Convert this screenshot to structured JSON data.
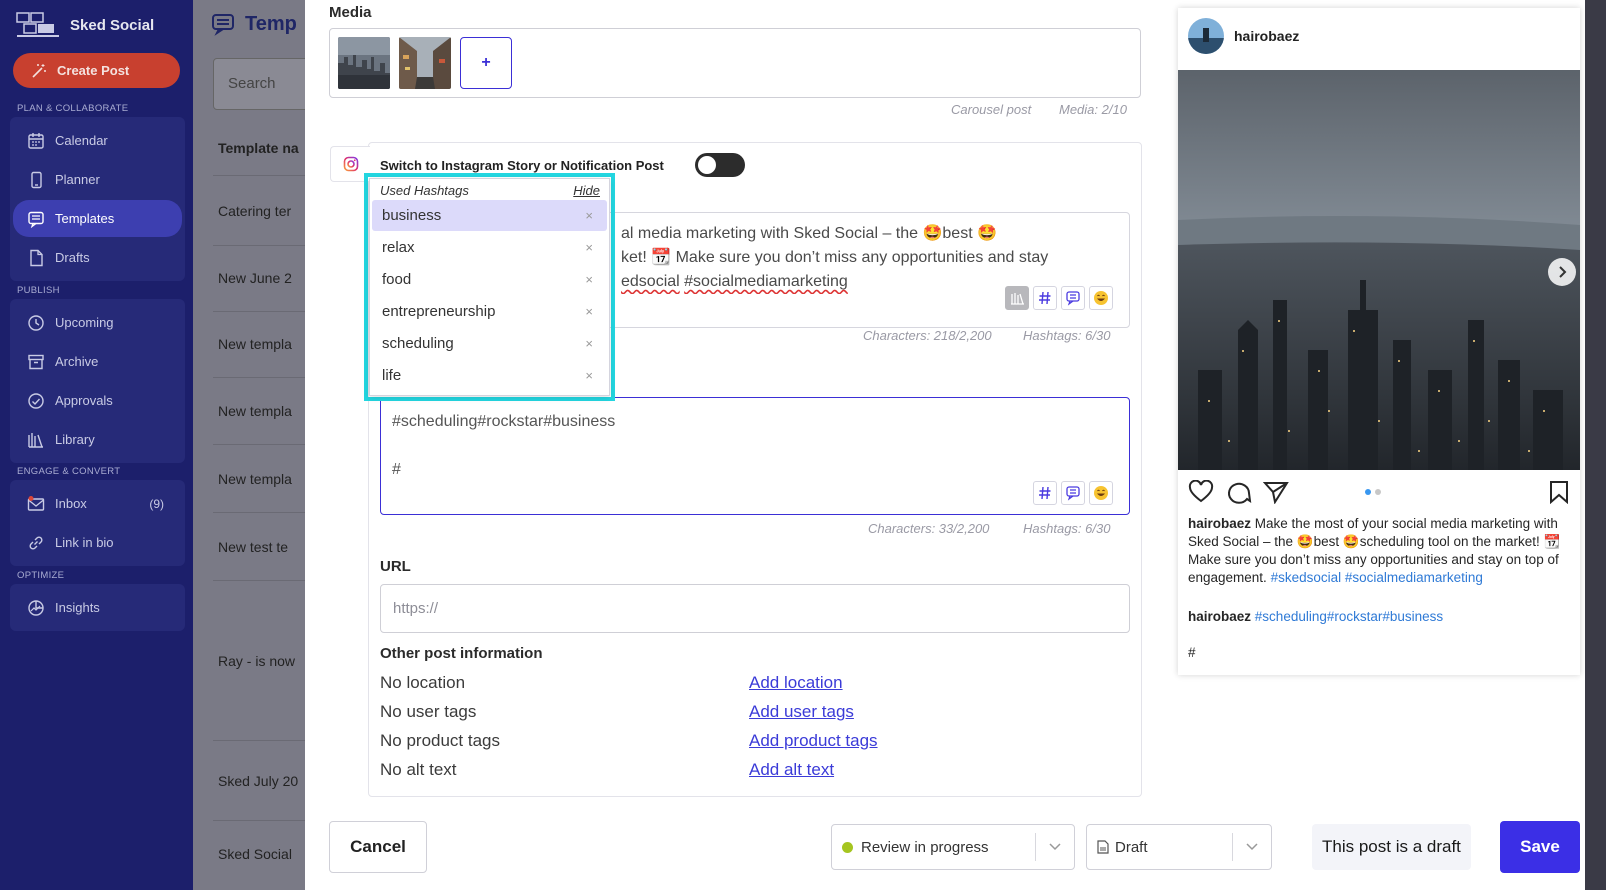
{
  "app": {
    "name": "Sked Social"
  },
  "sidebar": {
    "create_label": "Create Post",
    "sections": [
      {
        "label": "PLAN & COLLABORATE",
        "items": [
          {
            "label": "Calendar",
            "icon": "calendar-icon"
          },
          {
            "label": "Planner",
            "icon": "phone-icon"
          },
          {
            "label": "Templates",
            "icon": "chat-icon",
            "active": true
          },
          {
            "label": "Drafts",
            "icon": "document-icon"
          }
        ]
      },
      {
        "label": "PUBLISH",
        "items": [
          {
            "label": "Upcoming",
            "icon": "clock-icon"
          },
          {
            "label": "Archive",
            "icon": "archive-icon"
          },
          {
            "label": "Approvals",
            "icon": "check-circle-icon"
          },
          {
            "label": "Library",
            "icon": "library-icon"
          }
        ]
      },
      {
        "label": "ENGAGE & CONVERT",
        "items": [
          {
            "label": "Inbox",
            "icon": "mail-icon",
            "badge": "(9)"
          },
          {
            "label": "Link in bio",
            "icon": "link-icon"
          }
        ]
      },
      {
        "label": "OPTIMIZE",
        "items": [
          {
            "label": "Insights",
            "icon": "insights-icon"
          }
        ]
      }
    ]
  },
  "background": {
    "title": "Temp",
    "search_placeholder": "Search",
    "column": "Template na",
    "rows": [
      "Catering ter",
      "New June 2",
      "New templa",
      "New templa",
      "New templa",
      "New test te",
      "Ray - is now",
      "Sked July 20",
      "Sked Social"
    ]
  },
  "modal": {
    "media_label": "Media",
    "media_add": "+",
    "carousel_label": "Carousel post",
    "media_count": "Media: 2/10",
    "switch_label": "Switch to Instagram Story or Notification Post",
    "caption": {
      "line1": "al media marketing with Sked Social – the 🤩best 🤩",
      "line2": "ket! 📆 Make sure you don’t miss any opportunities and stay",
      "line3a": "edsocial",
      "line3b": "#socialmediamarketing"
    },
    "caption_chars": "Characters: 218/2,200",
    "caption_hashtags": "Hashtags: 6/30",
    "comment_text": "#scheduling#rockstar#business\n\n#",
    "comment_chars": "Characters: 33/2,200",
    "comment_hashtags": "Hashtags: 6/30",
    "url_label": "URL",
    "url_placeholder": "https://",
    "other_label": "Other post information",
    "info": [
      {
        "status": "No location",
        "link": "Add location"
      },
      {
        "status": "No user tags",
        "link": "Add user tags"
      },
      {
        "status": "No product tags",
        "link": "Add product tags"
      },
      {
        "status": "No alt text",
        "link": "Add alt text"
      }
    ],
    "hashtags": {
      "title": "Used Hashtags",
      "hide_label": "Hide",
      "items": [
        "business",
        "relax",
        "food",
        "entrepreneurship",
        "scheduling",
        "life"
      ],
      "remove_glyph": "×"
    }
  },
  "preview": {
    "username": "hairobaez",
    "caption_user": "hairobaez",
    "caption": "Make the most of your social media marketing with Sked Social – the 🤩best 🤩scheduling tool on the market! 📆 Make sure you don’t miss any opportunities and stay on top of engagement.",
    "caption_tags": "#skedsocial #socialmediamarketing",
    "comment_user": "hairobaez",
    "comment_tags": "#scheduling#rockstar#business",
    "comment_extra": "#"
  },
  "footer": {
    "cancel": "Cancel",
    "review_status": "Review in progress",
    "draft_select": "Draft",
    "draft_note": "This post is a draft",
    "save": "Save"
  },
  "colors": {
    "sidebar": "#1c1f6b",
    "accent": "#3b2fe6",
    "create": "#c8402f",
    "highlight": "#23d6e0",
    "status": "#a5c520"
  }
}
